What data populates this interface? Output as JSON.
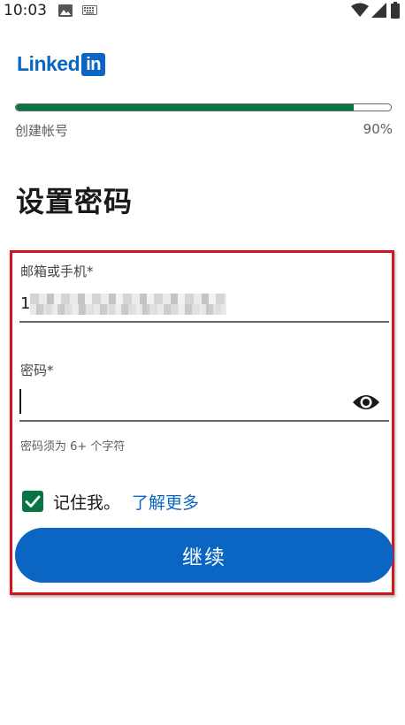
{
  "status_bar": {
    "time": "10:03",
    "icons": [
      "gallery-icon",
      "keyboard-icon",
      "wifi-icon",
      "signal-icon",
      "battery-icon"
    ]
  },
  "logo": {
    "word": "Linked",
    "box": "in",
    "color": "#0a66c2"
  },
  "progress": {
    "label": "创建帐号",
    "percent_text": "90%",
    "value": 0.9,
    "color": "#057642"
  },
  "page_title": "设置密码",
  "form": {
    "email": {
      "label": "邮箱或手机*",
      "value": "1"
    },
    "password": {
      "label": "密码*",
      "value": "",
      "toggle_icon": "eye-icon"
    },
    "hint": "密码须为 6+ 个字符",
    "remember": {
      "checked": true,
      "label": "记住我。",
      "link": "了解更多"
    },
    "continue_label": "继续"
  },
  "colors": {
    "primary": "#0a66c2",
    "success": "#057642",
    "highlight": "#d2161b"
  }
}
